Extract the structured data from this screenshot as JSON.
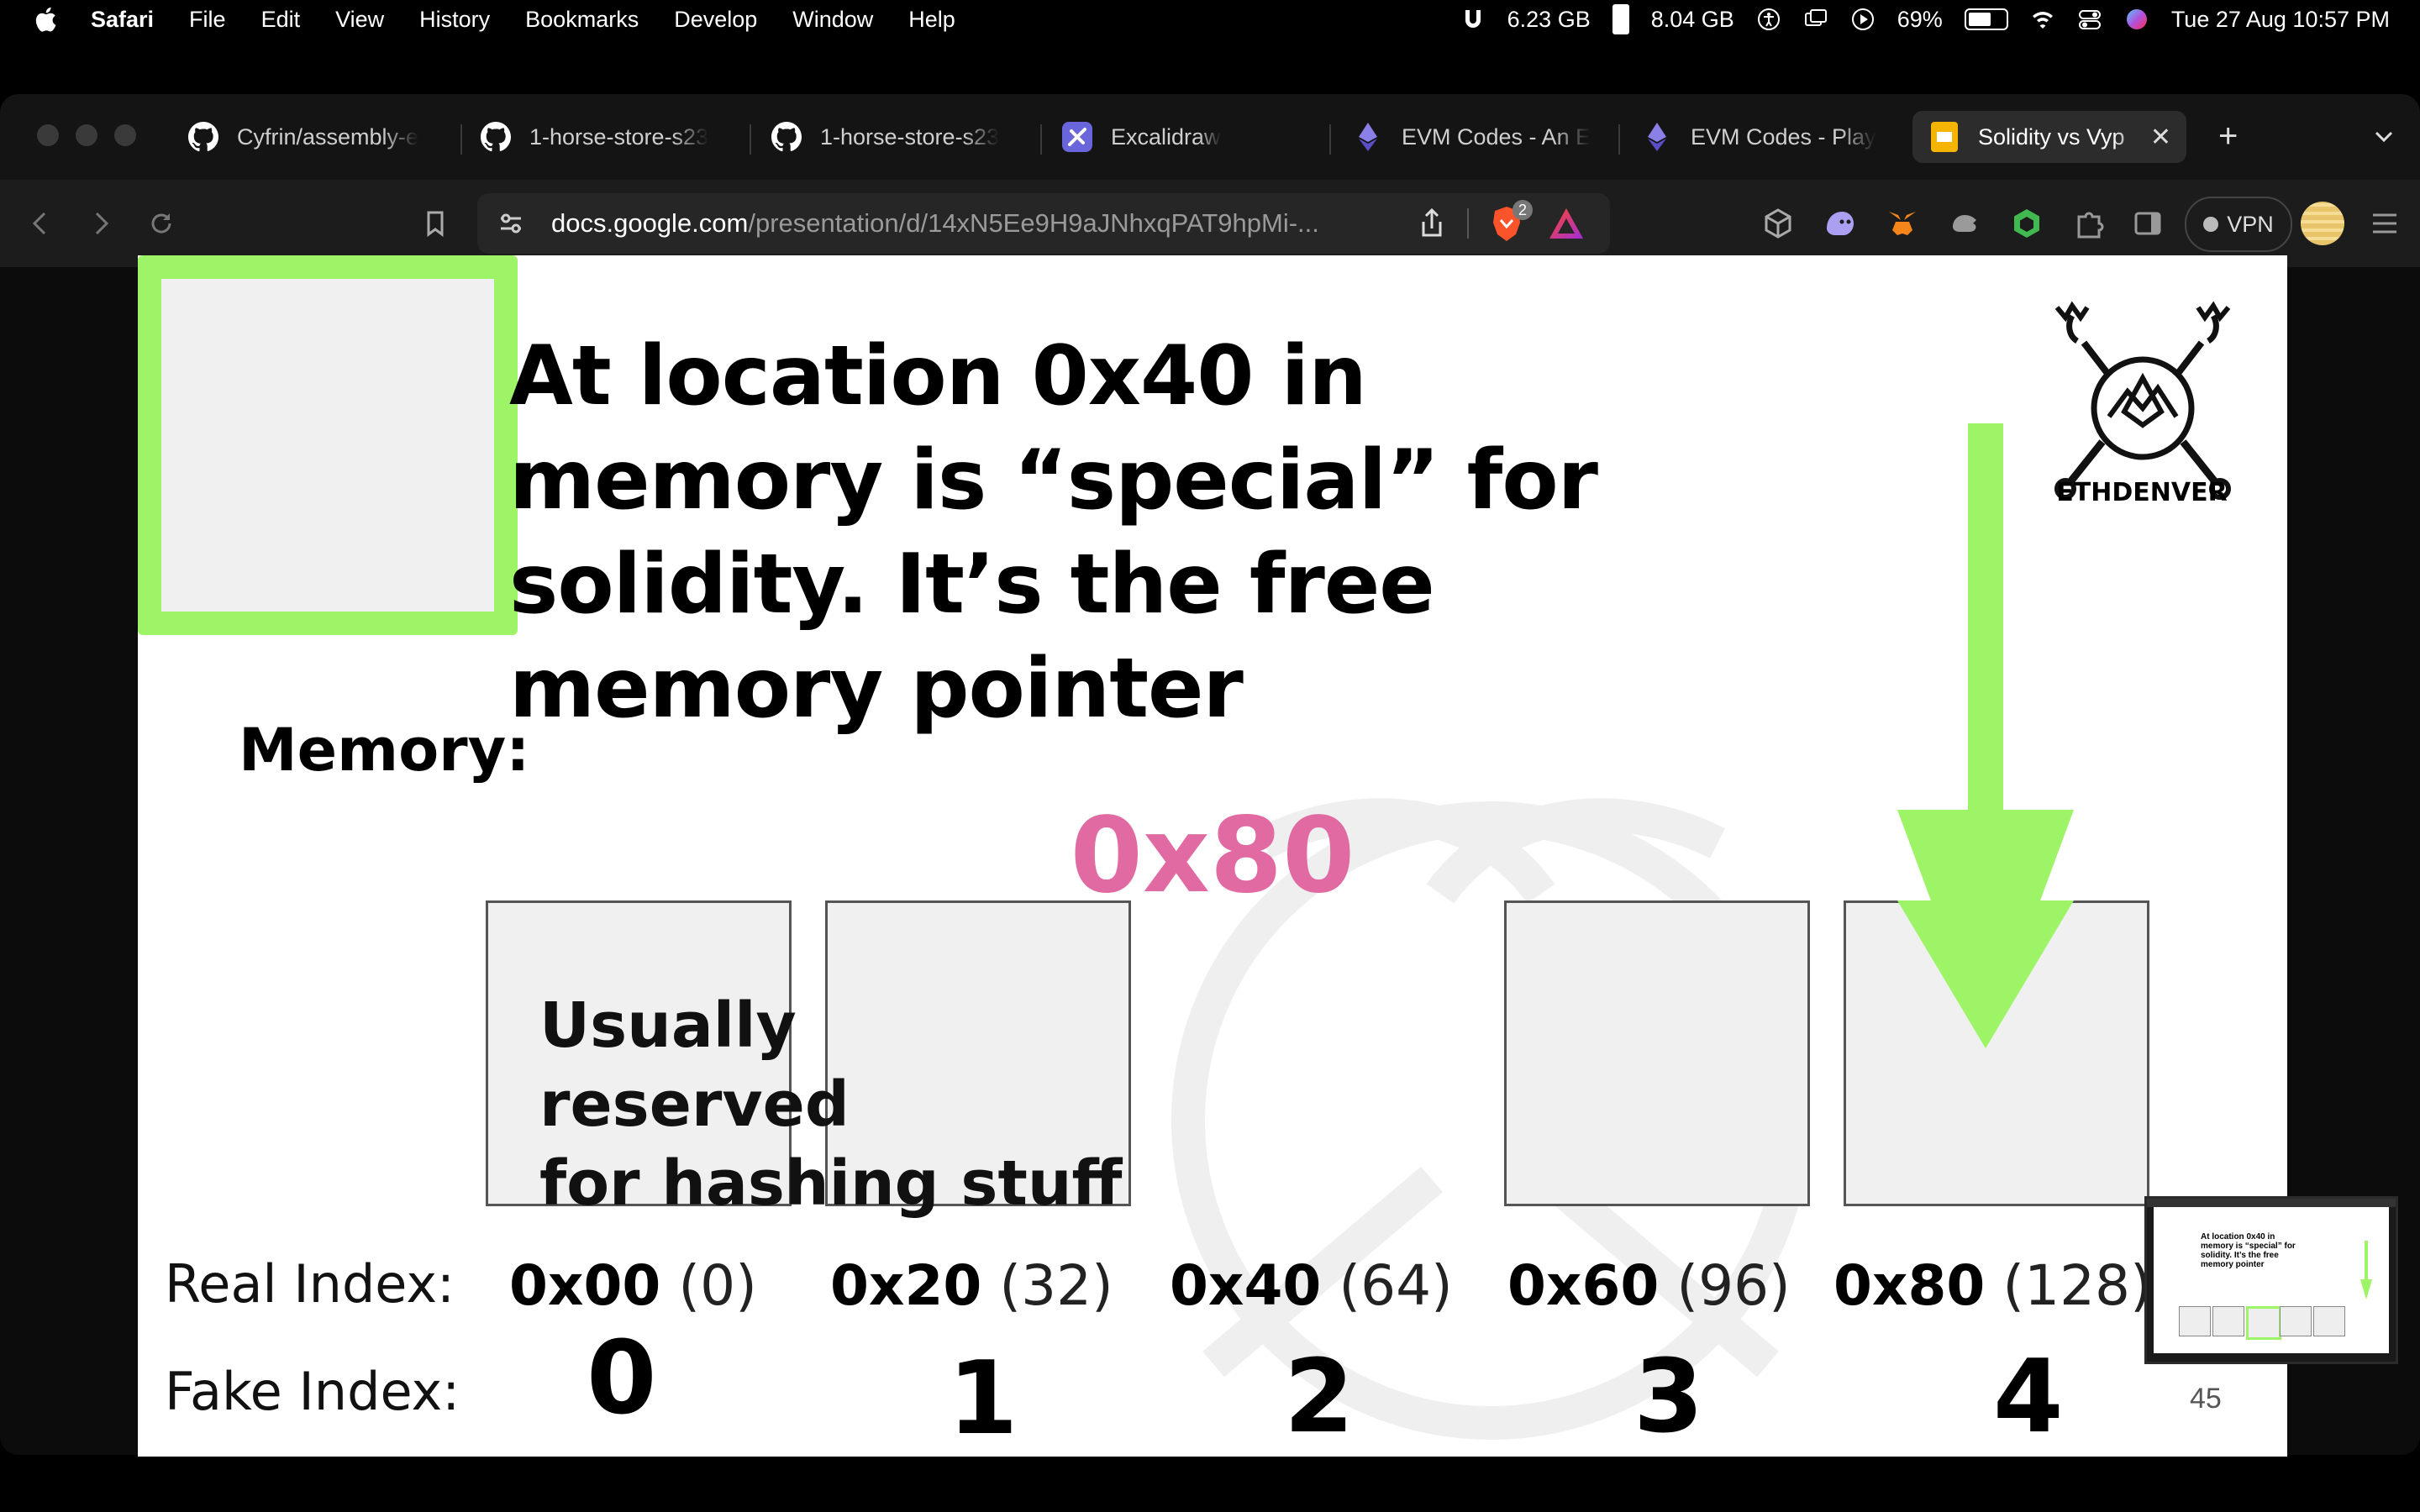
{
  "menubar": {
    "app_name": "Safari",
    "menus": [
      "File",
      "Edit",
      "View",
      "History",
      "Bookmarks",
      "Develop",
      "Window",
      "Help"
    ],
    "status": {
      "mem_used": "6.23 GB",
      "mem_total": "8.04 GB",
      "battery_percent": "69%",
      "battery_level": 0.69,
      "datetime": "Tue 27 Aug  10:57 PM"
    }
  },
  "tabs": [
    {
      "label": "Cyfrin/assembly-e",
      "icon": "github-icon",
      "active": false
    },
    {
      "label": "1-horse-store-s23",
      "icon": "github-icon",
      "active": false
    },
    {
      "label": "1-horse-store-s23",
      "icon": "github-icon",
      "active": false
    },
    {
      "label": "Excalidraw",
      "icon": "excalidraw-icon",
      "active": false
    },
    {
      "label": "EVM Codes - An E",
      "icon": "ethereum-icon",
      "active": false
    },
    {
      "label": "EVM Codes - Play",
      "icon": "ethereum-icon",
      "active": false
    },
    {
      "label": "Solidity vs Vyp",
      "icon": "google-slides-icon",
      "active": true
    }
  ],
  "toolbar": {
    "url_host": "docs.google.com",
    "url_path": "/presentation/d/14xN5Ee9H9aJNhxqPAT9hpMi-...",
    "shields_badge": "2",
    "vpn_label": "VPN"
  },
  "slide": {
    "title": "At location 0x40 in memory is “special” for solidity. It’s the free memory pointer",
    "memory_label": "Memory:",
    "reserved_note_line1": "Usually reserved",
    "reserved_note_line2": "for hashing stuff",
    "cell_2_value": "0x80",
    "highlight_color": "#9df467",
    "value_color": "#e26aa2",
    "logo_text": "ETHDENVER",
    "real_index_label": "Real Index:",
    "fake_index_label": "Fake Index:",
    "real_indexes": [
      {
        "hex": "0x00",
        "dec": "(0)"
      },
      {
        "hex": "0x20",
        "dec": "(32)"
      },
      {
        "hex": "0x40",
        "dec": "(64)"
      },
      {
        "hex": "0x60",
        "dec": "(96)"
      },
      {
        "hex": "0x80",
        "dec": "(128)"
      }
    ],
    "fake_indexes": [
      "0",
      "1",
      "2",
      "3",
      "4"
    ],
    "page_number": "45"
  }
}
